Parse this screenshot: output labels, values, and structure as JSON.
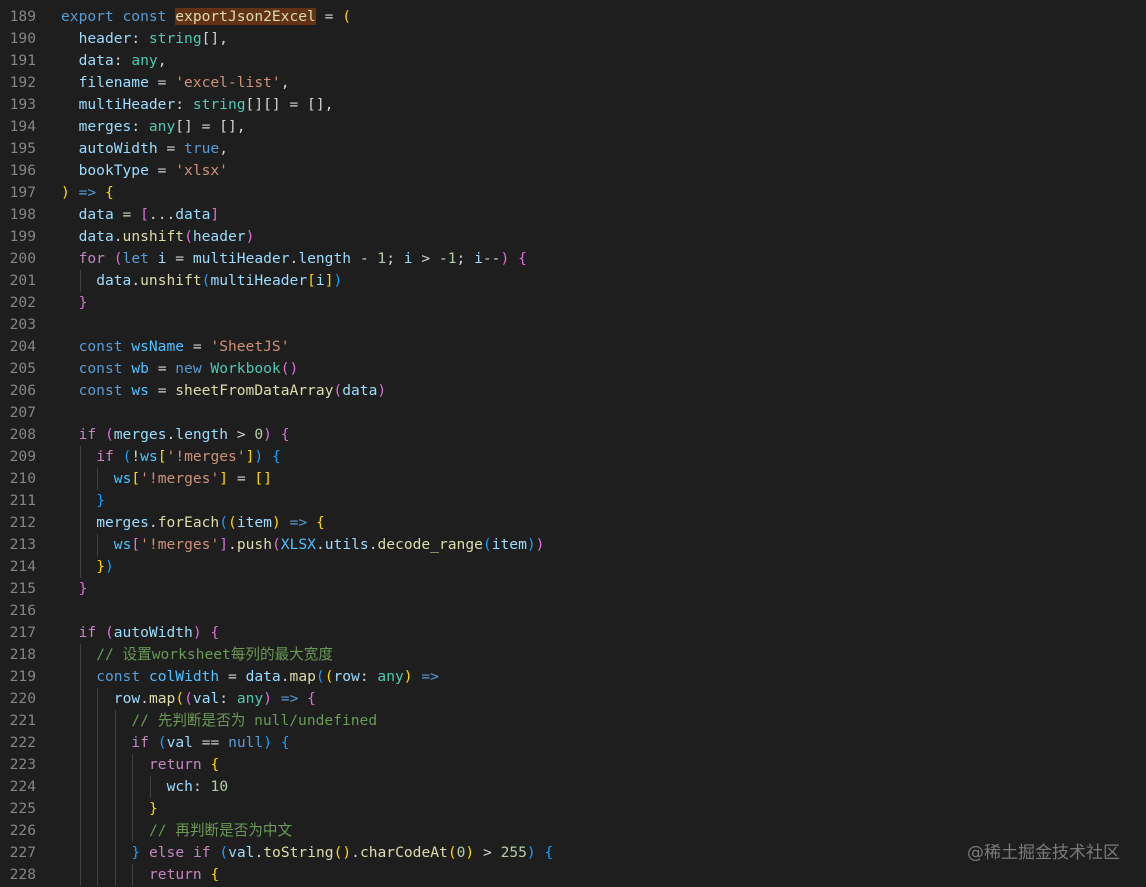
{
  "editor": {
    "lines": [
      {
        "n": "189",
        "indent": 0,
        "tokens": [
          [
            "kw",
            "export"
          ],
          [
            "pl",
            " "
          ],
          [
            "kw",
            "const"
          ],
          [
            "pl",
            " "
          ],
          [
            "fn hl",
            "exportJson2Excel"
          ],
          [
            "pl",
            " = "
          ],
          [
            "b1",
            "("
          ]
        ]
      },
      {
        "n": "190",
        "indent": 1,
        "tokens": [
          [
            "id",
            "header"
          ],
          [
            "pl",
            ": "
          ],
          [
            "ty",
            "string"
          ],
          [
            "pl",
            "[],"
          ]
        ]
      },
      {
        "n": "191",
        "indent": 1,
        "tokens": [
          [
            "id",
            "data"
          ],
          [
            "pl",
            ": "
          ],
          [
            "ty",
            "any"
          ],
          [
            "pl",
            ","
          ]
        ]
      },
      {
        "n": "192",
        "indent": 1,
        "tokens": [
          [
            "id",
            "filename"
          ],
          [
            "pl",
            " = "
          ],
          [
            "st",
            "'excel-list'"
          ],
          [
            "pl",
            ","
          ]
        ]
      },
      {
        "n": "193",
        "indent": 1,
        "tokens": [
          [
            "id",
            "multiHeader"
          ],
          [
            "pl",
            ": "
          ],
          [
            "ty",
            "string"
          ],
          [
            "pl",
            "[][] = [],"
          ]
        ]
      },
      {
        "n": "194",
        "indent": 1,
        "tokens": [
          [
            "id",
            "merges"
          ],
          [
            "pl",
            ": "
          ],
          [
            "ty",
            "any"
          ],
          [
            "pl",
            "[] = [],"
          ]
        ]
      },
      {
        "n": "195",
        "indent": 1,
        "tokens": [
          [
            "id",
            "autoWidth"
          ],
          [
            "pl",
            " = "
          ],
          [
            "kw",
            "true"
          ],
          [
            "pl",
            ","
          ]
        ]
      },
      {
        "n": "196",
        "indent": 1,
        "tokens": [
          [
            "id",
            "bookType"
          ],
          [
            "pl",
            " = "
          ],
          [
            "st",
            "'xlsx'"
          ]
        ]
      },
      {
        "n": "197",
        "indent": 0,
        "tokens": [
          [
            "b1",
            ")"
          ],
          [
            "pl",
            " "
          ],
          [
            "kw",
            "=>"
          ],
          [
            "pl",
            " "
          ],
          [
            "b1",
            "{"
          ]
        ]
      },
      {
        "n": "198",
        "indent": 1,
        "tokens": [
          [
            "id",
            "data"
          ],
          [
            "pl",
            " = "
          ],
          [
            "b2",
            "["
          ],
          [
            "pl",
            "..."
          ],
          [
            "id",
            "data"
          ],
          [
            "b2",
            "]"
          ]
        ]
      },
      {
        "n": "199",
        "indent": 1,
        "tokens": [
          [
            "id",
            "data"
          ],
          [
            "pl",
            "."
          ],
          [
            "fn",
            "unshift"
          ],
          [
            "b2",
            "("
          ],
          [
            "id",
            "header"
          ],
          [
            "b2",
            ")"
          ]
        ]
      },
      {
        "n": "200",
        "indent": 1,
        "tokens": [
          [
            "kw2",
            "for"
          ],
          [
            "pl",
            " "
          ],
          [
            "b2",
            "("
          ],
          [
            "kw",
            "let"
          ],
          [
            "pl",
            " "
          ],
          [
            "id",
            "i"
          ],
          [
            "pl",
            " = "
          ],
          [
            "id",
            "multiHeader"
          ],
          [
            "pl",
            "."
          ],
          [
            "id",
            "length"
          ],
          [
            "pl",
            " - "
          ],
          [
            "nm",
            "1"
          ],
          [
            "pl",
            "; "
          ],
          [
            "id",
            "i"
          ],
          [
            "pl",
            " > -"
          ],
          [
            "nm",
            "1"
          ],
          [
            "pl",
            "; "
          ],
          [
            "id",
            "i"
          ],
          [
            "pl",
            "--"
          ],
          [
            "b2",
            ")"
          ],
          [
            "pl",
            " "
          ],
          [
            "b2",
            "{"
          ]
        ]
      },
      {
        "n": "201",
        "indent": 2,
        "tokens": [
          [
            "id",
            "data"
          ],
          [
            "pl",
            "."
          ],
          [
            "fn",
            "unshift"
          ],
          [
            "b3",
            "("
          ],
          [
            "id",
            "multiHeader"
          ],
          [
            "b1",
            "["
          ],
          [
            "id",
            "i"
          ],
          [
            "b1",
            "]"
          ],
          [
            "b3",
            ")"
          ]
        ]
      },
      {
        "n": "202",
        "indent": 1,
        "tokens": [
          [
            "b2",
            "}"
          ]
        ]
      },
      {
        "n": "203",
        "indent": 1,
        "tokens": []
      },
      {
        "n": "204",
        "indent": 1,
        "tokens": [
          [
            "kw",
            "const"
          ],
          [
            "pl",
            " "
          ],
          [
            "c-var",
            "wsName"
          ],
          [
            "pl",
            " = "
          ],
          [
            "st",
            "'SheetJS'"
          ]
        ]
      },
      {
        "n": "205",
        "indent": 1,
        "tokens": [
          [
            "kw",
            "const"
          ],
          [
            "pl",
            " "
          ],
          [
            "c-var",
            "wb"
          ],
          [
            "pl",
            " = "
          ],
          [
            "kw",
            "new"
          ],
          [
            "pl",
            " "
          ],
          [
            "ty",
            "Workbook"
          ],
          [
            "b2",
            "()"
          ]
        ]
      },
      {
        "n": "206",
        "indent": 1,
        "tokens": [
          [
            "kw",
            "const"
          ],
          [
            "pl",
            " "
          ],
          [
            "c-var",
            "ws"
          ],
          [
            "pl",
            " = "
          ],
          [
            "fn",
            "sheetFromDataArray"
          ],
          [
            "b2",
            "("
          ],
          [
            "id",
            "data"
          ],
          [
            "b2",
            ")"
          ]
        ]
      },
      {
        "n": "207",
        "indent": 1,
        "tokens": []
      },
      {
        "n": "208",
        "indent": 1,
        "tokens": [
          [
            "kw2",
            "if"
          ],
          [
            "pl",
            " "
          ],
          [
            "b2",
            "("
          ],
          [
            "id",
            "merges"
          ],
          [
            "pl",
            "."
          ],
          [
            "id",
            "length"
          ],
          [
            "pl",
            " > "
          ],
          [
            "nm",
            "0"
          ],
          [
            "b2",
            ")"
          ],
          [
            "pl",
            " "
          ],
          [
            "b2",
            "{"
          ]
        ]
      },
      {
        "n": "209",
        "indent": 2,
        "tokens": [
          [
            "kw2",
            "if"
          ],
          [
            "pl",
            " "
          ],
          [
            "b3",
            "("
          ],
          [
            "pl",
            "!"
          ],
          [
            "c-var",
            "ws"
          ],
          [
            "b1",
            "["
          ],
          [
            "st",
            "'!merges'"
          ],
          [
            "b1",
            "]"
          ],
          [
            "b3",
            ")"
          ],
          [
            "pl",
            " "
          ],
          [
            "b3",
            "{"
          ]
        ]
      },
      {
        "n": "210",
        "indent": 3,
        "tokens": [
          [
            "c-var",
            "ws"
          ],
          [
            "b1",
            "["
          ],
          [
            "st",
            "'!merges'"
          ],
          [
            "b1",
            "]"
          ],
          [
            "pl",
            " = "
          ],
          [
            "b1",
            "[]"
          ]
        ]
      },
      {
        "n": "211",
        "indent": 2,
        "tokens": [
          [
            "b3",
            "}"
          ]
        ]
      },
      {
        "n": "212",
        "indent": 2,
        "tokens": [
          [
            "id",
            "merges"
          ],
          [
            "pl",
            "."
          ],
          [
            "fn",
            "forEach"
          ],
          [
            "b3",
            "("
          ],
          [
            "b1",
            "("
          ],
          [
            "id",
            "item"
          ],
          [
            "b1",
            ")"
          ],
          [
            "pl",
            " "
          ],
          [
            "kw",
            "=>"
          ],
          [
            "pl",
            " "
          ],
          [
            "b1",
            "{"
          ]
        ]
      },
      {
        "n": "213",
        "indent": 3,
        "tokens": [
          [
            "c-var",
            "ws"
          ],
          [
            "b2",
            "["
          ],
          [
            "st",
            "'!merges'"
          ],
          [
            "b2",
            "]"
          ],
          [
            "pl",
            "."
          ],
          [
            "fn",
            "push"
          ],
          [
            "b2",
            "("
          ],
          [
            "c-var",
            "XLSX"
          ],
          [
            "pl",
            "."
          ],
          [
            "id",
            "utils"
          ],
          [
            "pl",
            "."
          ],
          [
            "fn",
            "decode_range"
          ],
          [
            "b3",
            "("
          ],
          [
            "id",
            "item"
          ],
          [
            "b3",
            ")"
          ],
          [
            "b2",
            ")"
          ]
        ]
      },
      {
        "n": "214",
        "indent": 2,
        "tokens": [
          [
            "b1",
            "}"
          ],
          [
            "b3",
            ")"
          ]
        ]
      },
      {
        "n": "215",
        "indent": 1,
        "tokens": [
          [
            "b2",
            "}"
          ]
        ]
      },
      {
        "n": "216",
        "indent": 1,
        "tokens": []
      },
      {
        "n": "217",
        "indent": 1,
        "tokens": [
          [
            "kw2",
            "if"
          ],
          [
            "pl",
            " "
          ],
          [
            "b2",
            "("
          ],
          [
            "id",
            "autoWidth"
          ],
          [
            "b2",
            ")"
          ],
          [
            "pl",
            " "
          ],
          [
            "b2",
            "{"
          ]
        ]
      },
      {
        "n": "218",
        "indent": 2,
        "tokens": [
          [
            "cm",
            "// 设置worksheet每列的最大宽度"
          ]
        ]
      },
      {
        "n": "219",
        "indent": 2,
        "tokens": [
          [
            "kw",
            "const"
          ],
          [
            "pl",
            " "
          ],
          [
            "c-var",
            "colWidth"
          ],
          [
            "pl",
            " = "
          ],
          [
            "id",
            "data"
          ],
          [
            "pl",
            "."
          ],
          [
            "fn",
            "map"
          ],
          [
            "b3",
            "("
          ],
          [
            "b1",
            "("
          ],
          [
            "id",
            "row"
          ],
          [
            "pl",
            ": "
          ],
          [
            "ty",
            "any"
          ],
          [
            "b1",
            ")"
          ],
          [
            "pl",
            " "
          ],
          [
            "kw",
            "=>"
          ]
        ]
      },
      {
        "n": "220",
        "indent": 3,
        "tokens": [
          [
            "id",
            "row"
          ],
          [
            "pl",
            "."
          ],
          [
            "fn",
            "map"
          ],
          [
            "b1",
            "("
          ],
          [
            "b2",
            "("
          ],
          [
            "id",
            "val"
          ],
          [
            "pl",
            ": "
          ],
          [
            "ty",
            "any"
          ],
          [
            "b2",
            ")"
          ],
          [
            "pl",
            " "
          ],
          [
            "kw",
            "=>"
          ],
          [
            "pl",
            " "
          ],
          [
            "b2",
            "{"
          ]
        ]
      },
      {
        "n": "221",
        "indent": 4,
        "tokens": [
          [
            "cm",
            "// 先判断是否为 null/undefined"
          ]
        ]
      },
      {
        "n": "222",
        "indent": 4,
        "tokens": [
          [
            "kw2",
            "if"
          ],
          [
            "pl",
            " "
          ],
          [
            "b3",
            "("
          ],
          [
            "id",
            "val"
          ],
          [
            "pl",
            " == "
          ],
          [
            "kw",
            "null"
          ],
          [
            "b3",
            ")"
          ],
          [
            "pl",
            " "
          ],
          [
            "b3",
            "{"
          ]
        ]
      },
      {
        "n": "223",
        "indent": 5,
        "tokens": [
          [
            "kw2",
            "return"
          ],
          [
            "pl",
            " "
          ],
          [
            "b1",
            "{"
          ]
        ]
      },
      {
        "n": "224",
        "indent": 6,
        "tokens": [
          [
            "id",
            "wch"
          ],
          [
            "pl",
            ": "
          ],
          [
            "nm",
            "10"
          ]
        ]
      },
      {
        "n": "225",
        "indent": 5,
        "tokens": [
          [
            "b1",
            "}"
          ]
        ]
      },
      {
        "n": "226",
        "indent": 5,
        "tokens": [
          [
            "cm",
            "// 再判断是否为中文"
          ]
        ]
      },
      {
        "n": "227",
        "indent": 4,
        "tokens": [
          [
            "b3",
            "}"
          ],
          [
            "pl",
            " "
          ],
          [
            "kw2",
            "else"
          ],
          [
            "pl",
            " "
          ],
          [
            "kw2",
            "if"
          ],
          [
            "pl",
            " "
          ],
          [
            "b3",
            "("
          ],
          [
            "id",
            "val"
          ],
          [
            "pl",
            "."
          ],
          [
            "fn",
            "toString"
          ],
          [
            "b1",
            "()"
          ],
          [
            "pl",
            "."
          ],
          [
            "fn",
            "charCodeAt"
          ],
          [
            "b1",
            "("
          ],
          [
            "nm",
            "0"
          ],
          [
            "b1",
            ")"
          ],
          [
            "pl",
            " > "
          ],
          [
            "nm",
            "255"
          ],
          [
            "b3",
            ")"
          ],
          [
            "pl",
            " "
          ],
          [
            "b3",
            "{"
          ]
        ]
      },
      {
        "n": "228",
        "indent": 5,
        "tokens": [
          [
            "kw2",
            "return"
          ],
          [
            "pl",
            " "
          ],
          [
            "b1",
            "{"
          ]
        ]
      }
    ]
  },
  "watermark": "@稀土掘金技术社区"
}
